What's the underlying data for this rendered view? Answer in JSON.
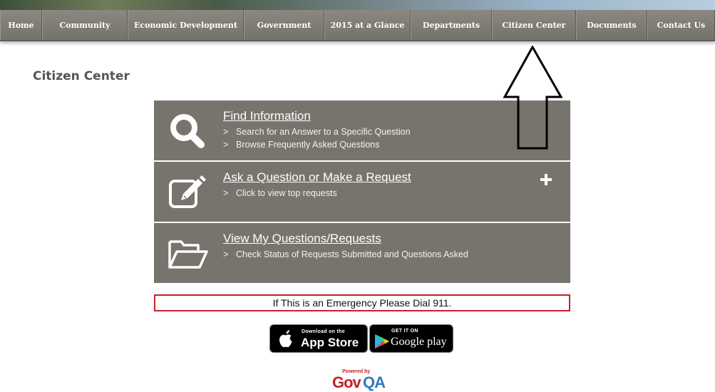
{
  "nav": {
    "items": [
      {
        "label": "Home"
      },
      {
        "label": "Community"
      },
      {
        "label": "Economic Development"
      },
      {
        "label": "Government"
      },
      {
        "label": "2015 at a Glance"
      },
      {
        "label": "Departments"
      },
      {
        "label": "Citizen Center"
      },
      {
        "label": "Documents"
      },
      {
        "label": "Contact Us"
      }
    ]
  },
  "page": {
    "title": "Citizen Center"
  },
  "panels": {
    "find": {
      "title": "Find Information",
      "subs": [
        "Search for an Answer to a Specific Question",
        "Browse Frequently Asked Questions"
      ]
    },
    "ask": {
      "title": "Ask a Question or Make a Request",
      "subs": [
        "Click to view top requests"
      ]
    },
    "view": {
      "title": "View My Questions/Requests",
      "subs": [
        "Check Status of Requests Submitted and Questions Asked"
      ]
    },
    "chevron": ">"
  },
  "emergency": {
    "text": "If This is an Emergency Please Dial 911."
  },
  "apps": {
    "appstore": {
      "small": "Download on the",
      "big": "App Store"
    },
    "googleplay": {
      "small": "GET IT ON",
      "big": "Google play"
    }
  },
  "footer": {
    "powered": "Powered by",
    "brand_gov": "Gov",
    "brand_qa": "QA"
  },
  "icons": [
    "search-icon",
    "edit-icon",
    "folder-icon",
    "plus-icon",
    "apple-icon",
    "play-icon"
  ]
}
